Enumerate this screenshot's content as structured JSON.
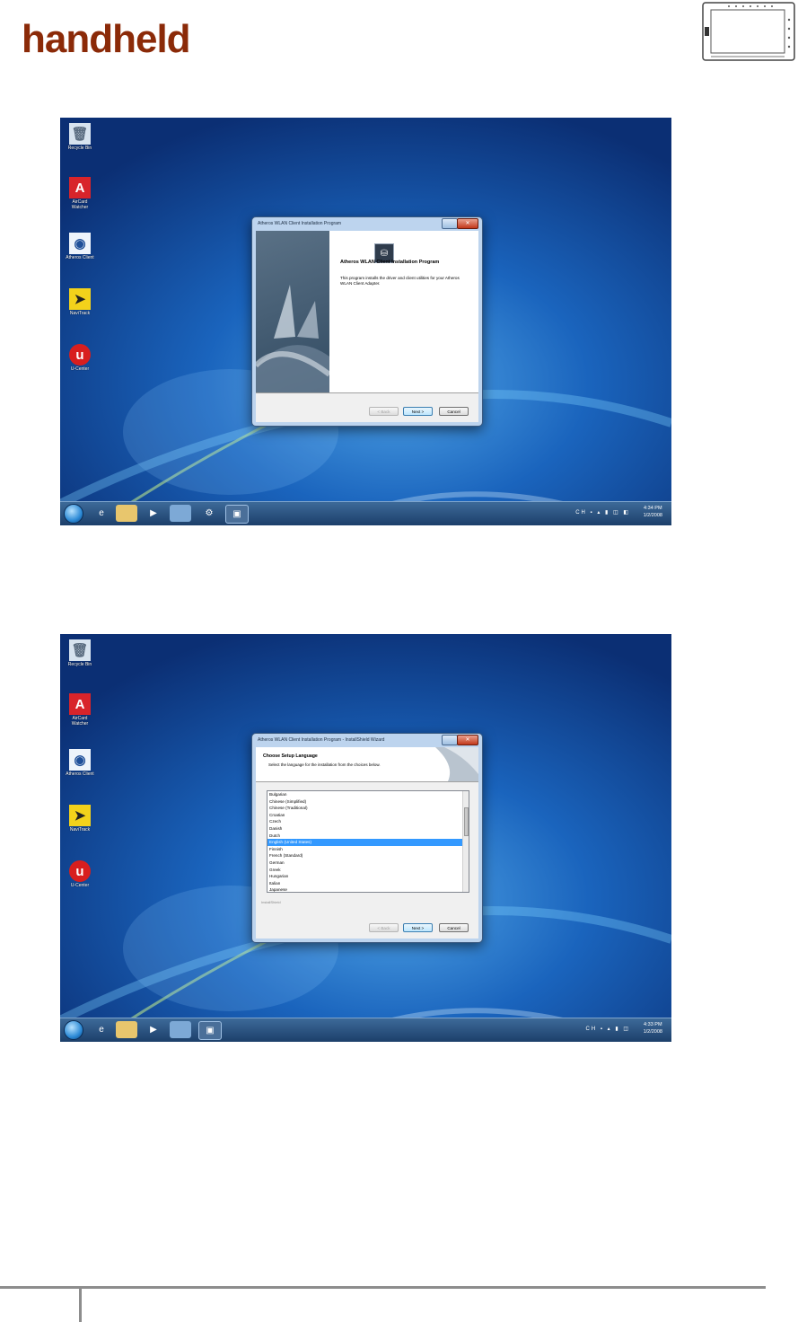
{
  "header": {
    "brand": "handheld"
  },
  "screens": [
    {
      "desktop_icons": [
        {
          "label": "Recycle Bin",
          "icon": "recycle-bin-icon"
        },
        {
          "label": "AirCard Watcher",
          "icon": "aircard-icon"
        },
        {
          "label": "Atheros Client",
          "icon": "atheros-icon"
        },
        {
          "label": "NaviTrack",
          "icon": "navigation-icon"
        },
        {
          "label": "U-Center",
          "icon": "u-center-icon"
        }
      ],
      "taskbar": {
        "buttons": [
          "internet-explorer-icon",
          "folder-icon",
          "media-player-icon",
          "network-icon",
          "tool-icon",
          "installer-icon"
        ],
        "time": "4:34 PM",
        "date": "1/2/2008"
      },
      "dialog": {
        "title": "Atheros WLAN Client Installation Program",
        "heading": "Atheros WLAN Client Installation Program",
        "body": "This program installs the driver and client utilities for your Atheros WLAN Client Adapter.",
        "buttons": {
          "back": "< Back",
          "next": "Next >",
          "cancel": "Cancel"
        }
      }
    },
    {
      "desktop_icons": [
        {
          "label": "Recycle Bin",
          "icon": "recycle-bin-icon"
        },
        {
          "label": "AirCard Watcher",
          "icon": "aircard-icon"
        },
        {
          "label": "Atheros Client",
          "icon": "atheros-icon"
        },
        {
          "label": "NaviTrack",
          "icon": "navigation-icon"
        },
        {
          "label": "U-Center",
          "icon": "u-center-icon"
        }
      ],
      "taskbar": {
        "buttons": [
          "internet-explorer-icon",
          "folder-icon",
          "media-player-icon",
          "network-icon",
          "installer-icon"
        ],
        "time": "4:33 PM",
        "date": "1/2/2008"
      },
      "dialog": {
        "title": "Atheros WLAN Client Installation Program - InstallShield Wizard",
        "heading": "Choose Setup Language",
        "subheading": "Select the language for the installation from the choices below.",
        "languages": [
          "Bulgarian",
          "Chinese (Simplified)",
          "Chinese (Traditional)",
          "Croatian",
          "Czech",
          "Danish",
          "Dutch",
          "English (United States)",
          "Finnish",
          "French (Standard)",
          "German",
          "Greek",
          "Hungarian",
          "Italian",
          "Japanese"
        ],
        "selected_language": "English (United States)",
        "group_label": "InstallShield",
        "buttons": {
          "back": "< Back",
          "next": "Next >",
          "cancel": "Cancel"
        }
      }
    }
  ]
}
